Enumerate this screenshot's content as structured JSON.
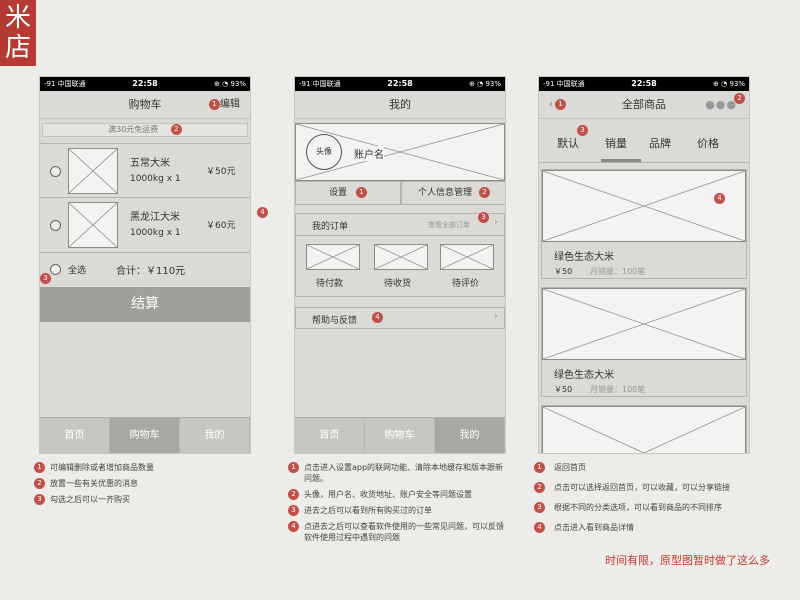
{
  "logo": {
    "chars": [
      "米",
      "店"
    ]
  },
  "status": {
    "left": "-91 中国联通 ",
    "time": "22:58",
    "right": "⊕ ◔ 93%"
  },
  "cart": {
    "title": "购物车",
    "edit": "编辑",
    "shipping": "满30元免运费",
    "items": [
      {
        "name": "五常大米",
        "qty": "1000kg x 1",
        "price": "￥50元"
      },
      {
        "name": "黑龙江大米",
        "qty": "1000kg x 1",
        "price": "￥60元"
      }
    ],
    "select_all": "全选",
    "total": "合计：￥110元",
    "checkout": "结算",
    "tabs": [
      "首页",
      "购物车",
      "我的"
    ]
  },
  "mine": {
    "title": "我的",
    "avatar": "头像",
    "account": "账户名",
    "settings": "设置",
    "profile": "个人信息管理",
    "orders": "我的订单",
    "all_orders": "查看全部订单",
    "order_states": [
      "待付款",
      "待收货",
      "待评价"
    ],
    "help": "帮助与反馈",
    "tabs": [
      "首页",
      "购物车",
      "我的"
    ]
  },
  "products": {
    "title": "全部商品",
    "tabs": [
      "默认",
      "销量",
      "品牌",
      "价格"
    ],
    "items": [
      {
        "name": "绿色生态大米",
        "price": "￥50",
        "sales": "月销量：100笔"
      },
      {
        "name": "绿色生态大米",
        "price": "￥50",
        "sales": "月销量：100笔"
      }
    ]
  },
  "notes": {
    "cart": [
      "可编辑删除或者增加商品数量",
      "放置一些有关优惠的消息",
      "勾选之后可以一齐购买"
    ],
    "mine": [
      "点击进入设置app的联网功能、清除本地缓存和版本跟新问题。",
      "头像，用户名、收货地址、账户安全等问题设置",
      "进去之后可以看到所有购买过的订单",
      "点进去之后可以查看软件使用的一些常见问题，可以反馈软件使用过程中遇到的问题"
    ],
    "products": [
      "返回首页",
      "点击可以选择返回首页，可以收藏，可以分享链接",
      "根据不同的分类选项，可以看到商品的不同排序",
      "点击进入看到商品详情"
    ]
  },
  "footer": "时间有限，原型图暂时做了这么多",
  "colors": {
    "accent": "#b53a34",
    "badge": "#c2504a",
    "footer": "#c0392b"
  }
}
